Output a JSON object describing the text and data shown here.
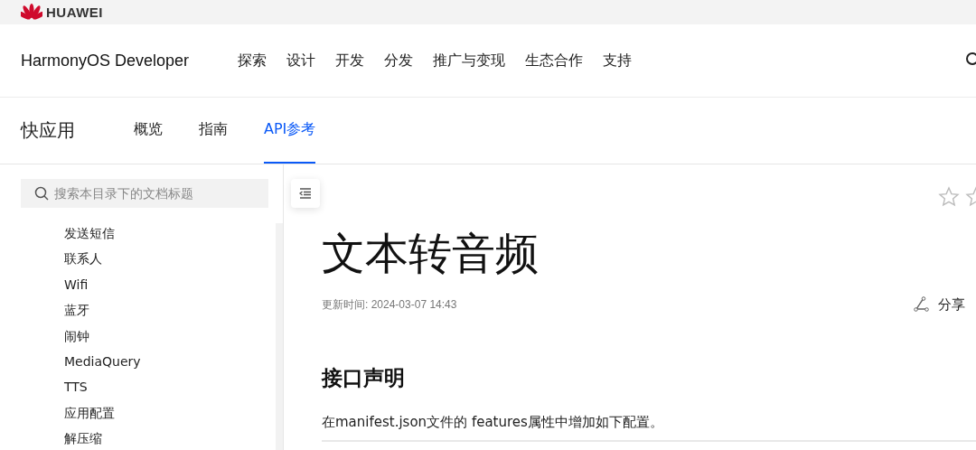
{
  "brand": {
    "company": "HUAWEI",
    "product": "HarmonyOS Developer"
  },
  "nav": [
    {
      "label": "探索"
    },
    {
      "label": "设计"
    },
    {
      "label": "开发"
    },
    {
      "label": "分发"
    },
    {
      "label": "推广与变现"
    },
    {
      "label": "生态合作"
    },
    {
      "label": "支持"
    }
  ],
  "section": {
    "title": "快应用",
    "tabs": [
      {
        "label": "概览",
        "selected": false
      },
      {
        "label": "指南",
        "selected": false
      },
      {
        "label": "API参考",
        "selected": true
      }
    ]
  },
  "sidebar": {
    "search": {
      "placeholder": "搜索本目录下的文档标题"
    },
    "items": [
      {
        "label": "发送短信"
      },
      {
        "label": "联系人"
      },
      {
        "label": "Wifi"
      },
      {
        "label": "蓝牙"
      },
      {
        "label": "闹钟"
      },
      {
        "label": "MediaQuery"
      },
      {
        "label": "TTS"
      },
      {
        "label": "应用配置"
      },
      {
        "label": "解压缩"
      }
    ]
  },
  "article": {
    "title": "文本转音频",
    "updated": "更新时间: 2024-03-07 14:43",
    "share": "分享",
    "heading": "接口声明",
    "paragraph": "在manifest.json文件的 features属性中增加如下配置。"
  }
}
